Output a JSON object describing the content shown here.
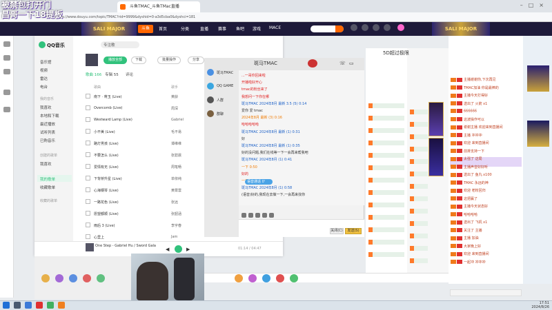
{
  "overlay": {
    "line1": "被禁包打开门",
    "line2": "昌哥一下18提板"
  },
  "browser": {
    "tab_title": "斗鱼TMAC_斗鱼TMac直播",
    "url": "https://www.douyu.com/topic/TMAC?rid=9999&dyshid=0-a3d5cba0&dyshci=181"
  },
  "site": {
    "logo": "斗鱼",
    "banner": "SALI MAJOR",
    "nav": [
      "首页",
      "分类",
      "直播",
      "赛事",
      "鱼吧",
      "游戏",
      "MACE"
    ],
    "search_placeholder": ""
  },
  "qqmusic": {
    "app_name": "QQ音乐",
    "search_text": "专注歌",
    "sidebar_items": [
      "音乐馆",
      "视频",
      "雷达",
      "电台"
    ],
    "sidebar_section_mine": "我的音乐",
    "sidebar_mine_items": [
      "我喜欢",
      "本地和下载",
      "最近播放",
      "试听列表",
      "已购音乐"
    ],
    "sidebar_section_created": "创建的歌单",
    "sidebar_created_items": [
      "我喜欢",
      "我的歌单",
      "收藏歌单"
    ],
    "sidebar_section_collect": "收藏的歌单",
    "play_all": "播放全部",
    "pill_buttons": [
      "下载",
      "批量操作",
      "分享"
    ],
    "tabs": [
      "歌曲 166",
      "专辑 55",
      "评论"
    ],
    "columns": [
      "歌曲",
      "歌手"
    ],
    "songs": [
      {
        "title": "南下 · 蒋玉 (Live)",
        "artist": "黄龄"
      },
      {
        "title": "Overcomb (Live)",
        "artist": "周深"
      },
      {
        "title": "Westward Lamp (Live)",
        "artist": "Gabriel"
      },
      {
        "title": "小不美 (Live)",
        "artist": "毛不易"
      },
      {
        "title": "路灯男孩 (Live)",
        "artist": "谭维维"
      },
      {
        "title": "不要怎么 (Live)",
        "artist": "张碧晨"
      },
      {
        "title": "爱情有无 (Live)",
        "artist": "周笔畅"
      },
      {
        "title": "下背桥升星 (Live)",
        "artist": "单依纯"
      },
      {
        "title": "心海钢琴 (Live)",
        "artist": "黄霄雲"
      },
      {
        "title": "一路花色 (Live)",
        "artist": "张远"
      },
      {
        "title": "愿望都顺 (Live)",
        "artist": "张韶涵"
      },
      {
        "title": "雨后 3 (Live)",
        "artist": "李宇春"
      },
      {
        "title": "心里上",
        "artist": "Jam"
      }
    ],
    "now_playing": "One Step - Gabriel Hu / Sword Gala",
    "time": "01:14 / 04:47"
  },
  "chat": {
    "title": "斑马TMAC",
    "contacts": [
      "斑马TMAC",
      "QQ GAME",
      "人群",
      "群聊"
    ],
    "messages": [
      {
        "text": "...一哥你回来啦",
        "c": "red"
      },
      {
        "text": "开播啦好开心",
        "c": "red"
      },
      {
        "text": "tmac的粉丝来了",
        "c": "red"
      },
      {
        "text": "我想问一下你在哪",
        "c": "red"
      },
      {
        "text": "斑马TMAC 2024年8月 最新 3.5 (5) 0:14",
        "c": "blue"
      },
      {
        "text": "爱你 爱 tmac",
        "c": "black"
      },
      {
        "text": "2024年8月 最新 (3) 0:16",
        "c": "orange"
      },
      {
        "text": "哈哈哈哈哈",
        "c": "red"
      },
      {
        "text": "斑马TMAC 2024年8月 最新 (1) 0:31",
        "c": "blue"
      },
      {
        "text": "好",
        "c": "black"
      },
      {
        "text": "斑马TMAC 2024年8月 最新 (1) 0:35",
        "c": "blue"
      },
      {
        "text": "好的没问题,我们在线等一下一会再来帮我吧",
        "c": "black"
      },
      {
        "text": "斑马TMAC 2024年8月 (1) 0:41",
        "c": "blue"
      },
      {
        "text": "一下 0:50",
        "c": "orange"
      },
      {
        "text": "好的",
        "c": "red"
      },
      {
        "text": "一下 0:53",
        "c": "orange"
      },
      {
        "text": "斑马TMAC 2024年8月 (1) 0:58",
        "c": "blue"
      },
      {
        "text": "(语音)好的,我现在去做一下,一会再来找你",
        "c": "black"
      }
    ],
    "voice_label": "语音通话 0'",
    "close_label": "关闭(C)",
    "send_label": "发送(S)"
  },
  "stream": {
    "title": "5D超过极限"
  },
  "right_chat": {
    "messages": [
      "主播谢谢你,下次再见",
      "TMAC加油 你是最棒的",
      "主播今天打得好",
      "送出了 火箭 x1",
      "666666",
      "这波操作可以",
      "谢谢主播 欢迎来到直播间",
      "主播 冲冲冲",
      "欢迎 来到直播间",
      "前排支持一下",
      "太强了 这局",
      "主播声音好好听",
      "送出了 鱼丸 x100",
      "TMAC 永远的神",
      "欢迎 老粉回归",
      "这把赢了",
      "主播今天状态好",
      "哈哈哈哈",
      "送出了 飞机 x1",
      "关注了 主播",
      "主播 加油",
      "大家晚上好",
      "欢迎 来到直播间",
      "一起冲 冲冲冲"
    ]
  },
  "taskbar": {
    "time": "17:51",
    "date": "2024/8/26"
  }
}
